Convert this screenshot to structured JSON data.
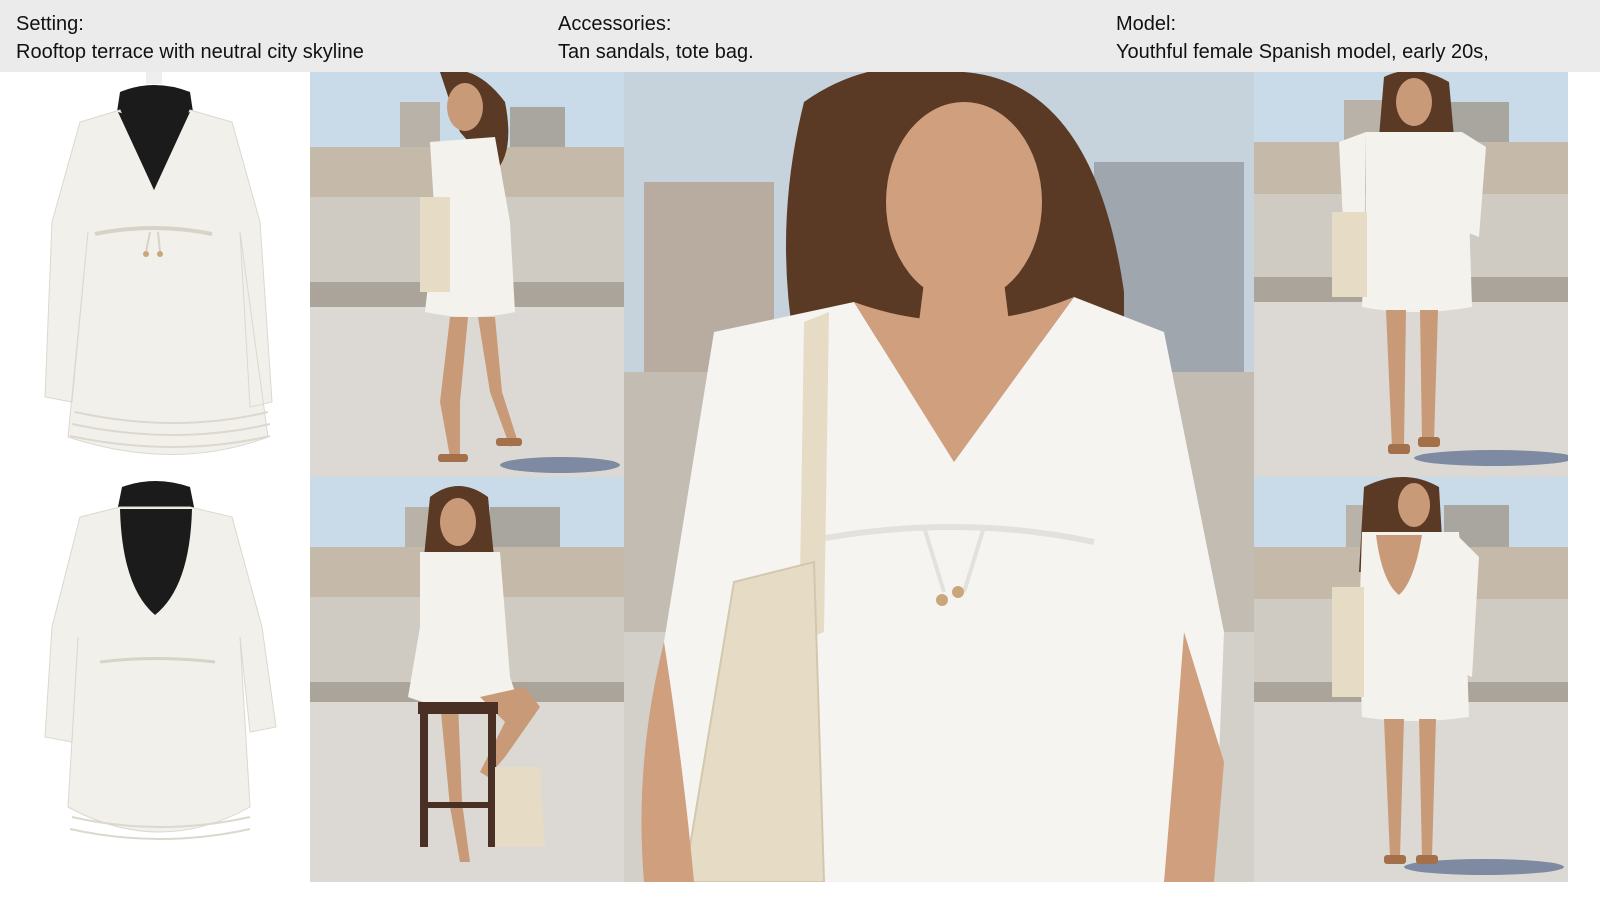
{
  "header": {
    "setting": {
      "label": "Setting:",
      "value": "Rooftop terrace with neutral city skyline"
    },
    "accessories": {
      "label": "Accessories:",
      "value": "Tan sandals, tote bag."
    },
    "model": {
      "label": "Model:",
      "value": "Youthful female Spanish model, early 20s,"
    }
  },
  "panels": [
    {
      "name": "dress-front-on-mannequin"
    },
    {
      "name": "dress-back-on-mannequin"
    },
    {
      "name": "model-side-view-on-phone"
    },
    {
      "name": "model-seated-on-stool"
    },
    {
      "name": "model-closeup-with-tote-bag"
    },
    {
      "name": "model-front-full-length"
    },
    {
      "name": "model-back-view-over-shoulder"
    }
  ],
  "colors": {
    "header_bg": "#ebebeb",
    "dress_white": "#f4f2ec",
    "sky": "#c9dbe9",
    "floor": "#dcd9d4",
    "wall": "#c8c3bb",
    "skin": "#c99a78",
    "hair": "#5a3a24",
    "tote": "#e6dcc6",
    "mannequin": "#1b1b1b"
  }
}
